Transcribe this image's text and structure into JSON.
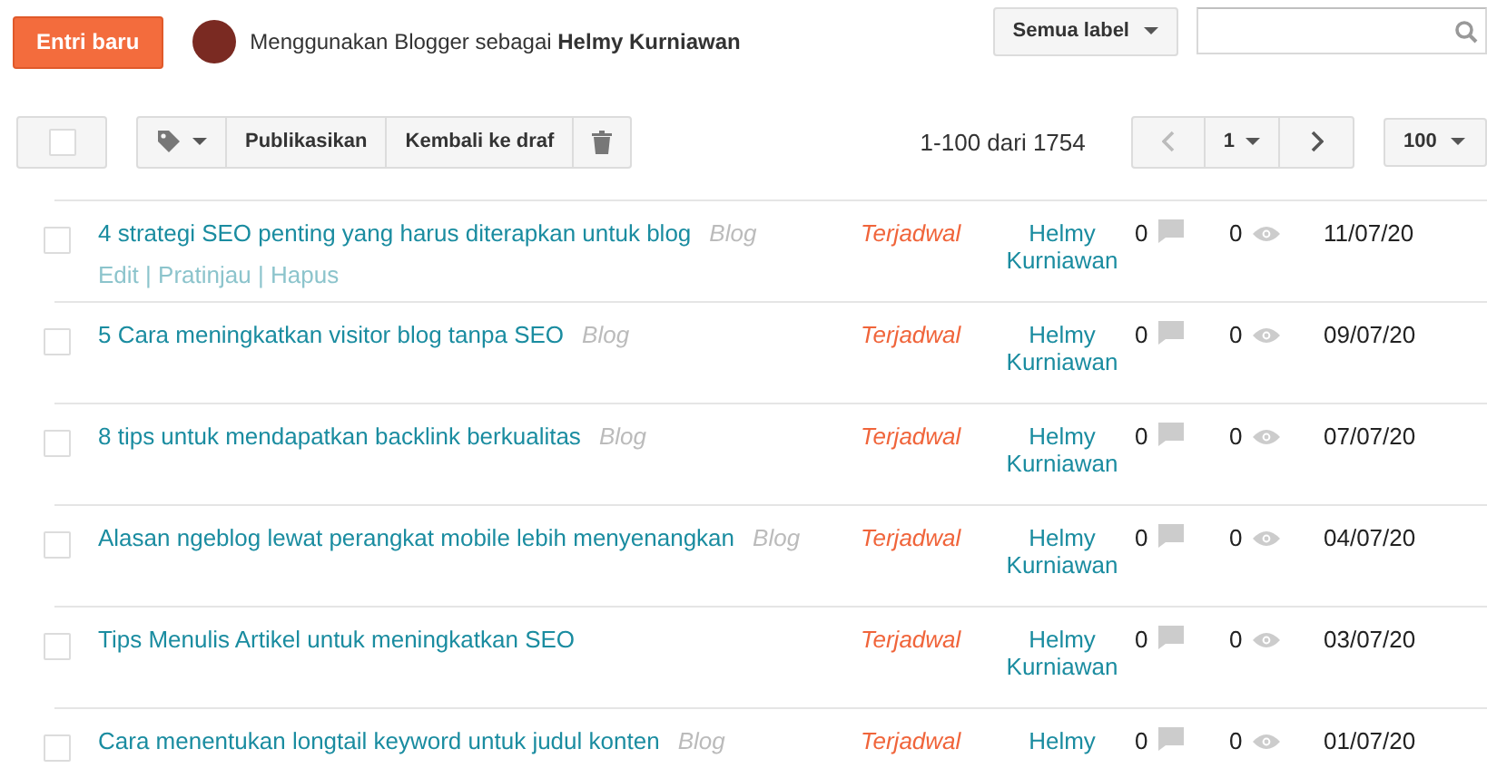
{
  "header": {
    "new_post_button": "Entri baru",
    "user_prefix": "Menggunakan Blogger sebagai",
    "user_name": "Helmy Kurniawan",
    "label_filter": "Semua label"
  },
  "toolbar": {
    "select_all": {
      "checked": false
    },
    "actions": [
      "Publikasikan",
      "Kembali ke draf"
    ],
    "range": "1-100 dari 1754",
    "page": "1",
    "per_page": "100"
  },
  "posts": [
    {
      "title": "4 strategi SEO penting yang harus diterapkan untuk blog",
      "label": "Blog",
      "actions": [
        "Edit",
        "Pratinjau",
        "Hapus"
      ],
      "action_separator": "|",
      "status": "Terjadwal",
      "author": "Helmy Kurniawan",
      "comments": "0",
      "views": "0",
      "date": "11/07/20",
      "checked": false
    },
    {
      "title": "5 Cara meningkatkan visitor blog tanpa SEO",
      "label": "Blog",
      "status": "Terjadwal",
      "author": "Helmy Kurniawan",
      "comments": "0",
      "views": "0",
      "date": "09/07/20",
      "checked": false
    },
    {
      "title": "8 tips untuk mendapatkan backlink berkualitas",
      "label": "Blog",
      "status": "Terjadwal",
      "author": "Helmy Kurniawan",
      "comments": "0",
      "views": "0",
      "date": "07/07/20",
      "checked": false
    },
    {
      "title": "Alasan ngeblog lewat perangkat mobile lebih menyenangkan",
      "label": "Blog",
      "status": "Terjadwal",
      "author": "Helmy Kurniawan",
      "comments": "0",
      "views": "0",
      "date": "04/07/20",
      "checked": false
    },
    {
      "title": "Tips Menulis Artikel untuk meningkatkan SEO",
      "status": "Terjadwal",
      "author": "Helmy Kurniawan",
      "comments": "0",
      "views": "0",
      "date": "03/07/20",
      "checked": false
    },
    {
      "title": "Cara menentukan longtail keyword untuk judul konten",
      "label": "Blog",
      "status": "Terjadwal",
      "author": "Helmy",
      "comments": "0",
      "views": "0",
      "date": "01/07/20",
      "checked": false
    }
  ]
}
